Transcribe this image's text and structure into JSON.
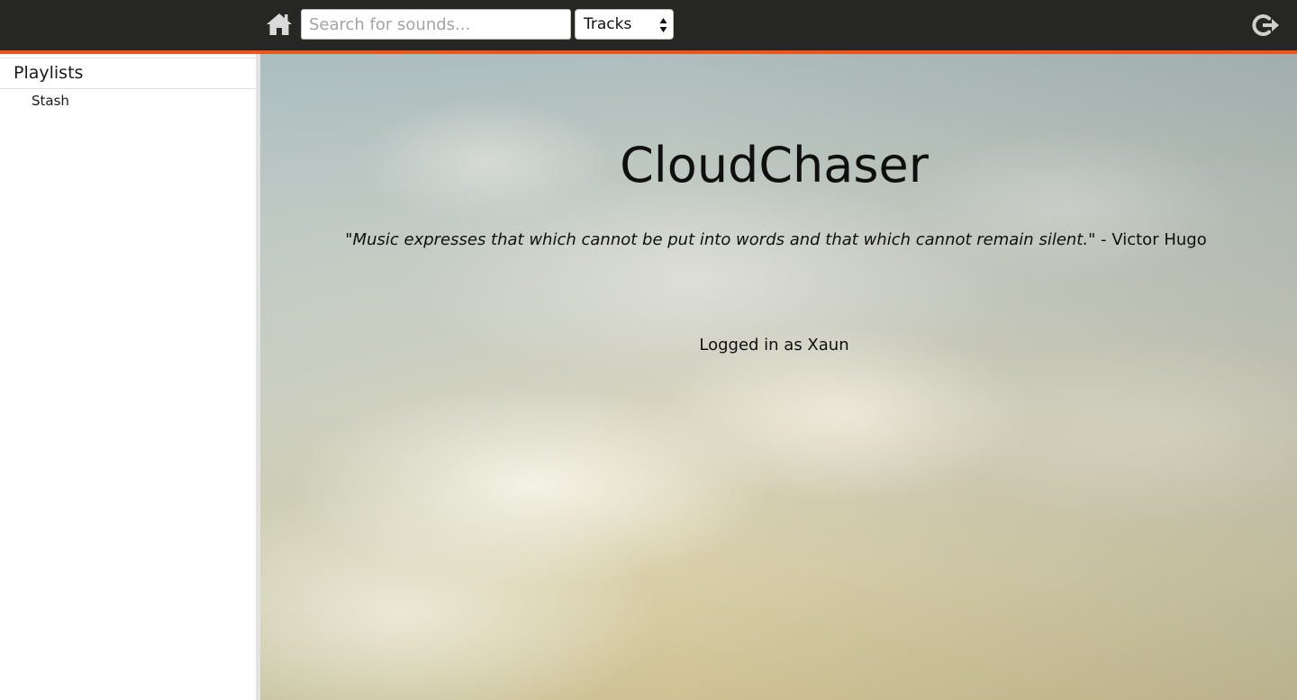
{
  "header": {
    "home_icon": "home-icon",
    "search": {
      "placeholder": "Search for sounds...",
      "value": ""
    },
    "type_select": {
      "selected": "Tracks"
    },
    "logout_icon": "logout-icon",
    "accent_color": "#e8561c",
    "background_color": "#262624"
  },
  "sidebar": {
    "title": "Playlists",
    "items": [
      {
        "label": "Stash"
      }
    ]
  },
  "main": {
    "title": "CloudChaser",
    "quote": {
      "text": "\"Music expresses that which cannot be put into words and that which cannot remain silent.\"",
      "author": " - Victor Hugo"
    },
    "status": "Logged in as Xaun"
  }
}
